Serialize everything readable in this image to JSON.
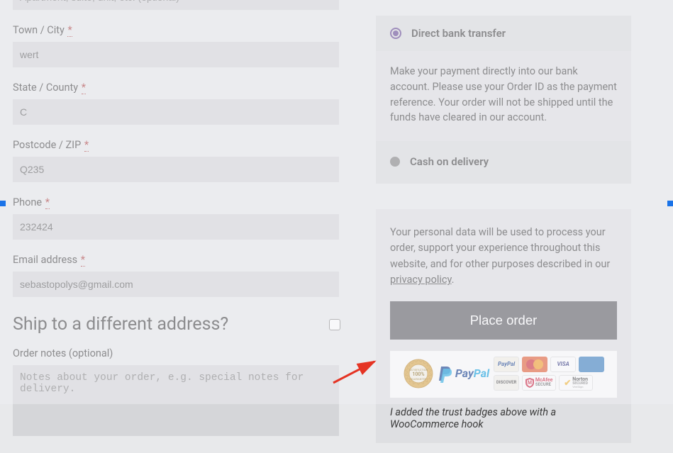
{
  "form": {
    "apt_placeholder": "Apartment, suite, unit, etc. (optional)",
    "town_label": "Town / City",
    "town_value": "wert",
    "state_label": "State / County",
    "state_value": "C",
    "postcode_label": "Postcode / ZIP",
    "postcode_value": "Q235",
    "phone_label": "Phone",
    "phone_value": "232424",
    "email_label": "Email address",
    "email_value": "sebastopolys@gmail.com",
    "ship_heading": "Ship to a different address?",
    "notes_label": "Order notes (optional)",
    "notes_placeholder": "Notes about your order, e.g. special notes for delivery.",
    "required_mark": "*"
  },
  "payment": {
    "option1_label": "Direct bank transfer",
    "option1_desc": "Make your payment directly into our bank account. Please use your Order ID as the payment reference. Your order will not be shipped until the funds have cleared in our account.",
    "option2_label": "Cash on delivery"
  },
  "privacy": {
    "text_part1": "Your personal data will be used to process your order, support your experience throughout this website, and for other purposes described in our ",
    "link_text": "privacy policy",
    "text_part2": ".",
    "place_order": "Place order"
  },
  "badges": {
    "seal_top": "SATISFACTION",
    "seal_mid": "100%",
    "seal_bot": "GUARANTEE",
    "paypal": "PayPal",
    "paypal_small": "PayPal",
    "discover": "DISCOVER",
    "visa": "VISA",
    "mcafee": "McAfee",
    "mcafee2": "SECURE",
    "norton": "Norton",
    "norton2": "SECURED",
    "verisign": "VeriSign"
  },
  "caption": "I added the trust badges above with a WooCommerce hook"
}
